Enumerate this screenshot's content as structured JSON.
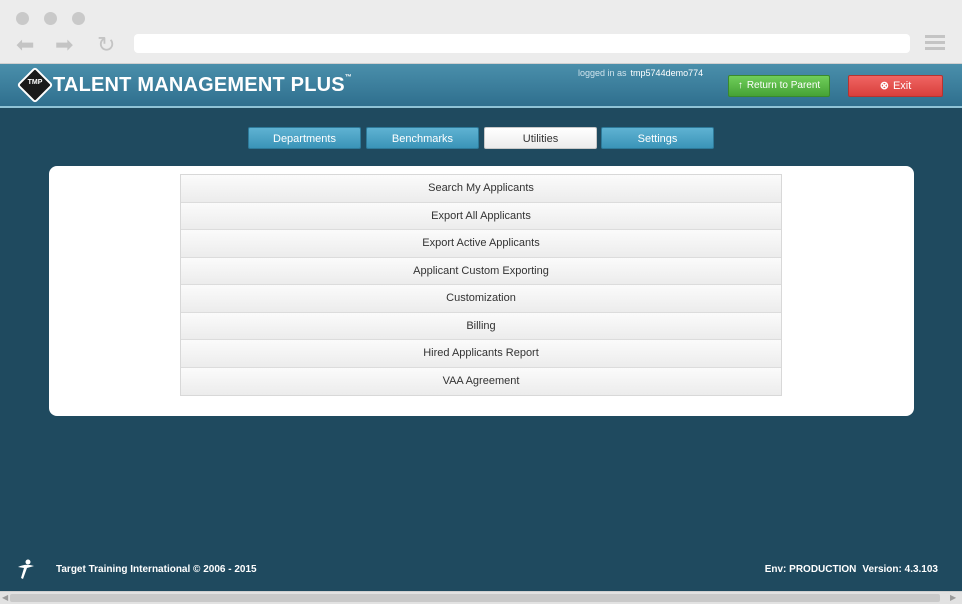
{
  "header": {
    "title": "TALENT MANAGEMENT PLUS",
    "trademark": "™",
    "logo_text": "TMP",
    "logged_in_label": "logged in as",
    "username": "tmp5744demo774",
    "return_label": "Return to Parent",
    "exit_label": "Exit"
  },
  "tabs": [
    {
      "label": "Departments",
      "active": false
    },
    {
      "label": "Benchmarks",
      "active": false
    },
    {
      "label": "Utilities",
      "active": true
    },
    {
      "label": "Settings",
      "active": false
    }
  ],
  "menu": {
    "items": [
      "Search My Applicants",
      "Export All Applicants",
      "Export Active Applicants",
      "Applicant Custom Exporting",
      "Customization",
      "Billing",
      "Hired Applicants Report",
      "VAA Agreement"
    ]
  },
  "footer": {
    "copyright": "Target Training International © 2006 - 2015",
    "env": "Env: PRODUCTION",
    "version": "Version: 4.3.103"
  },
  "colors": {
    "background": "#1f4a5f",
    "header": "#3a7d9c",
    "tab": "#4aa3c6",
    "return_button": "#55b544",
    "exit_button": "#e04b48"
  }
}
